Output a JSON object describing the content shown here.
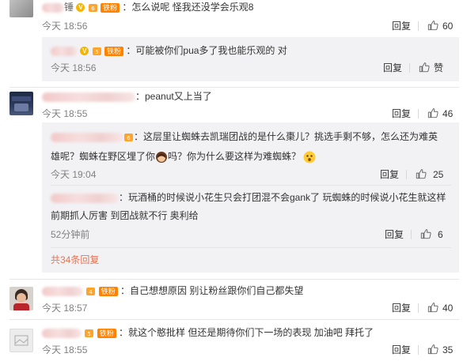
{
  "comments": [
    {
      "text": "：怎么说呢 怪我还没学会乐观8",
      "time": "今天 18:56",
      "reply_label": "回复",
      "like_count": "60",
      "fan_badge": "铁粉",
      "replies": [
        {
          "text": "：可能被你们pua多了我也能乐观的 对",
          "time": "今天 18:56",
          "reply_label": "回复",
          "like_label": "赞",
          "fan_badge": "铁粉"
        }
      ]
    },
    {
      "text": "：peanut又上当了",
      "time": "今天 18:55",
      "reply_label": "回复",
      "like_count": "46",
      "replies": [
        {
          "text_line1": "：这层里让蜘蛛去凯瑞团战的是什么棗儿？挑选手剩不够，怎么还为难英",
          "text_line2a": "雄呢？蜘蛛在野区埋了你",
          "text_line2b": "吗？你为什么要这样为难蜘蛛？",
          "time": "今天 19:04",
          "reply_label": "回复",
          "like_count": "25"
        },
        {
          "text_line1": "：玩酒桶的时候说小花生只会打团混不会gank了 玩蜘蛛的时候说小花生就这样",
          "text_line2": "前期抓人厉害 到团战就不行 奥利给",
          "time": "52分钟前",
          "reply_label": "回复",
          "like_count": "6"
        }
      ],
      "more_replies": "共34条回复"
    },
    {
      "text": "：自己想想原因 别让粉丝跟你们自己都失望",
      "time": "今天 18:57",
      "reply_label": "回复",
      "like_count": "40",
      "fan_badge": "铁粉"
    },
    {
      "text": "：就这个憨批样 但还是期待你们下一场的表现 加油吧 拜托了",
      "time": "今天 18:55",
      "reply_label": "回复",
      "like_count": "35",
      "fan_badge": "铁粉"
    }
  ],
  "icons": {
    "verified": "verified-v-icon",
    "level": "level-badge-icon",
    "thumb": "thumb-up-icon",
    "avatar": "user-avatar"
  },
  "colors": {
    "name": "#eb7350",
    "meta": "#808080",
    "reply_bg": "#f2f2f5",
    "fan_badge": "#ff8200"
  }
}
